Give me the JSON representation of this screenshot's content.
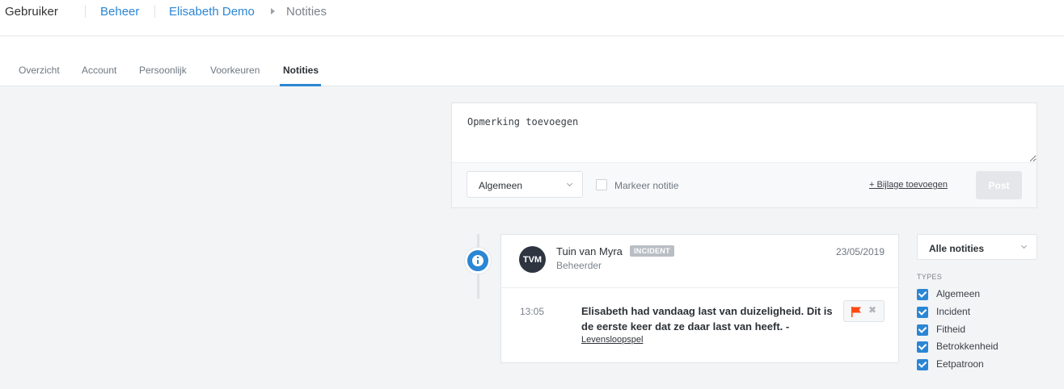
{
  "breadcrumb": {
    "user": "Gebruiker",
    "manage": "Beheer",
    "person": "Elisabeth Demo",
    "current": "Notities"
  },
  "tabs": [
    {
      "label": "Overzicht"
    },
    {
      "label": "Account"
    },
    {
      "label": "Persoonlijk"
    },
    {
      "label": "Voorkeuren"
    },
    {
      "label": "Notities",
      "active": true
    }
  ],
  "composer": {
    "placeholder": "Opmerking toevoegen",
    "type_value": "Algemeen",
    "mark_label": "Markeer notitie",
    "attach_label": "+ Bijlage toevoegen",
    "post_label": "Post"
  },
  "note": {
    "avatar": "TVM",
    "author": "Tuin van Myra",
    "badge": "INCIDENT",
    "role": "Beheerder",
    "date": "23/05/2019",
    "time": "13:05",
    "text": "Elisabeth had vandaag last van duizeligheid. Dit is de eerste keer dat ze daar last van heeft.  -",
    "source": "Levensloopspel"
  },
  "filter": {
    "value": "Alle notities",
    "types_title": "TYPES",
    "types": [
      {
        "label": "Algemeen",
        "checked": true
      },
      {
        "label": "Incident",
        "checked": true
      },
      {
        "label": "Fitheid",
        "checked": true
      },
      {
        "label": "Betrokkenheid",
        "checked": true
      },
      {
        "label": "Eetpatroon",
        "checked": true
      }
    ]
  },
  "colors": {
    "accent": "#2b86d4",
    "flag": "#ff4a12",
    "badge": "#b9bec5"
  }
}
